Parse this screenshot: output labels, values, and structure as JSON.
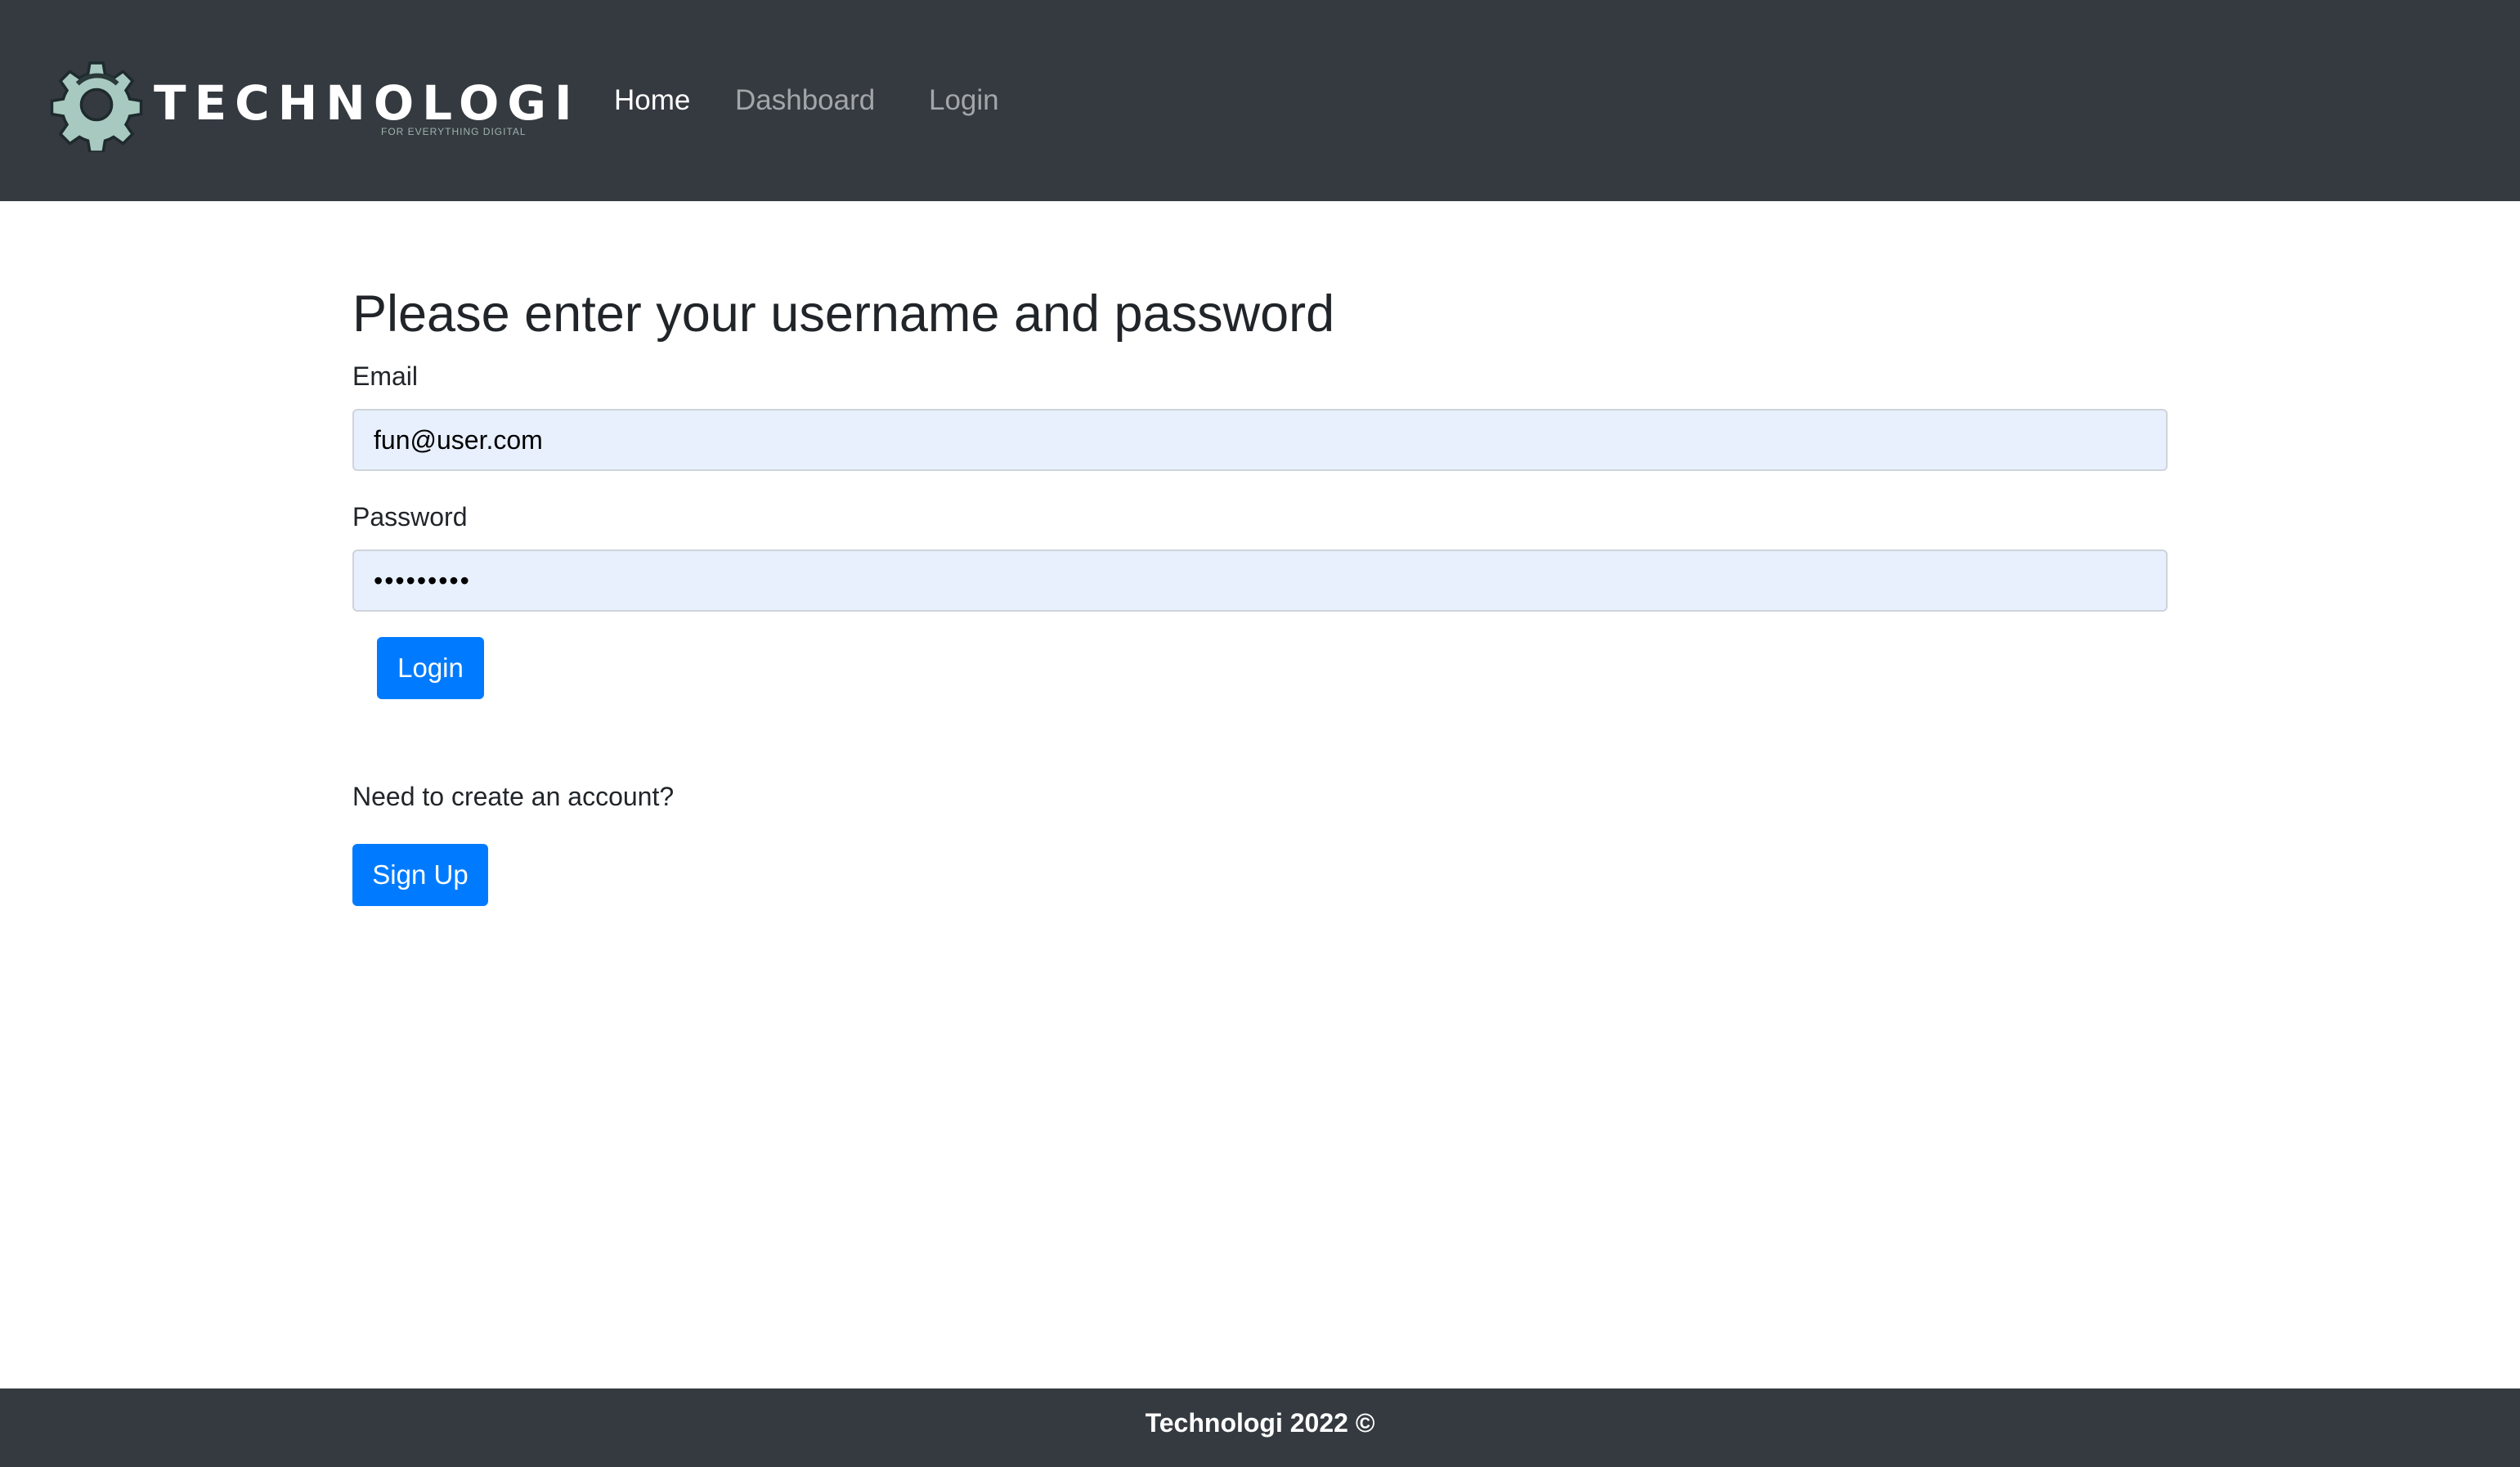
{
  "brand": {
    "name": "TECHNOLOGI",
    "tagline": "FOR EVERYTHING DIGITAL",
    "logo_icon": "gear-icon"
  },
  "nav": {
    "items": [
      {
        "label": "Home",
        "active": true
      },
      {
        "label": "Dashboard",
        "active": false
      },
      {
        "label": "Login",
        "active": false
      }
    ]
  },
  "form": {
    "title": "Please enter your username and password",
    "email_label": "Email",
    "email_value": "fun@user.com",
    "password_label": "Password",
    "password_value": "•••••••••",
    "login_button": "Login"
  },
  "signup": {
    "prompt": "Need to create an account?",
    "button": "Sign Up"
  },
  "footer": {
    "text": "Technologi 2022 ©"
  },
  "colors": {
    "navbar": "#343a40",
    "primary": "#007bff",
    "autofill": "#e8f0fe",
    "logo_gear": "#a8c9bf"
  }
}
